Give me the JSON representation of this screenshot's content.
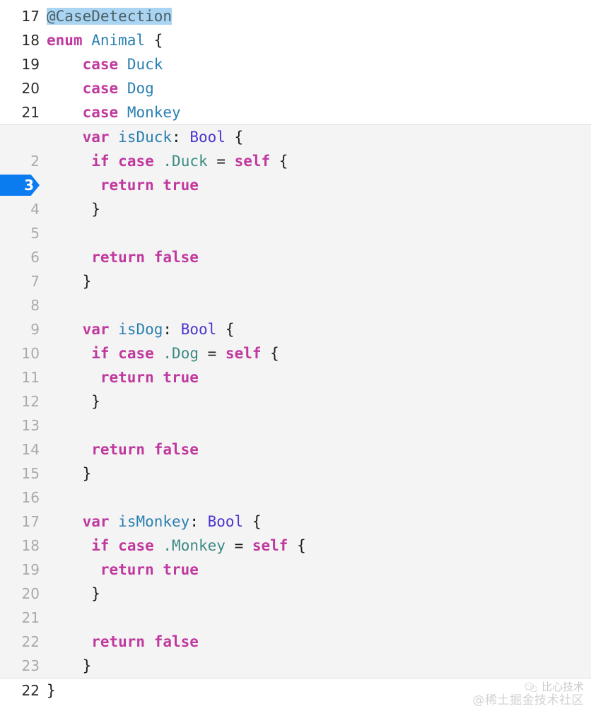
{
  "editor": {
    "language": "swift",
    "selection_text": "@CaseDetection",
    "current_line": "3",
    "colors": {
      "background": "#ffffff",
      "inner_background": "#f4f4f4",
      "divider": "#dcdcdc",
      "current_line_badge": "#0a7cf0",
      "selection": "#a9d4f2",
      "keyword": "#c0399e",
      "type": "#2a7fb0",
      "bool_type": "#4a35cf",
      "enum_member": "#3b8a84",
      "attribute": "#4a5f66",
      "punctuation": "#1c1c1c",
      "gutter_text": "#aaaaac"
    }
  },
  "panes": [
    {
      "id": "outer-top",
      "kind": "outer-top",
      "lines": [
        {
          "num": "17",
          "current": false,
          "tokens": [
            {
              "t": "@",
              "c": "attr sel"
            },
            {
              "t": "CaseDetection",
              "c": "attr sel"
            }
          ]
        },
        {
          "num": "18",
          "current": false,
          "tokens": [
            {
              "t": "enum",
              "c": "kw"
            },
            {
              "t": " ",
              "c": "punc"
            },
            {
              "t": "Animal",
              "c": "type"
            },
            {
              "t": " ",
              "c": "punc"
            },
            {
              "t": "{",
              "c": "punc"
            }
          ]
        },
        {
          "num": "19",
          "current": false,
          "tokens": [
            {
              "t": "    ",
              "c": "punc"
            },
            {
              "t": "case",
              "c": "kw"
            },
            {
              "t": " ",
              "c": "punc"
            },
            {
              "t": "Duck",
              "c": "type"
            }
          ]
        },
        {
          "num": "20",
          "current": false,
          "tokens": [
            {
              "t": "    ",
              "c": "punc"
            },
            {
              "t": "case",
              "c": "kw"
            },
            {
              "t": " ",
              "c": "punc"
            },
            {
              "t": "Dog",
              "c": "type"
            }
          ]
        },
        {
          "num": "21",
          "current": false,
          "tokens": [
            {
              "t": "    ",
              "c": "punc"
            },
            {
              "t": "case",
              "c": "kw"
            },
            {
              "t": " ",
              "c": "punc"
            },
            {
              "t": "Monkey",
              "c": "type"
            }
          ]
        }
      ]
    },
    {
      "id": "inner",
      "kind": "inner",
      "lines": [
        {
          "num": "",
          "current": false,
          "tokens": [
            {
              "t": "    ",
              "c": "punc"
            },
            {
              "t": "var",
              "c": "kw"
            },
            {
              "t": " ",
              "c": "punc"
            },
            {
              "t": "isDuck",
              "c": "ident"
            },
            {
              "t": ": ",
              "c": "punc"
            },
            {
              "t": "Bool",
              "c": "bool"
            },
            {
              "t": " {",
              "c": "punc"
            }
          ]
        },
        {
          "num": "2",
          "current": false,
          "tokens": [
            {
              "t": "     ",
              "c": "punc"
            },
            {
              "t": "if",
              "c": "kw"
            },
            {
              "t": " ",
              "c": "punc"
            },
            {
              "t": "case",
              "c": "kw"
            },
            {
              "t": " ",
              "c": "punc"
            },
            {
              "t": ".Duck",
              "c": "dot"
            },
            {
              "t": " = ",
              "c": "punc"
            },
            {
              "t": "self",
              "c": "kw"
            },
            {
              "t": " {",
              "c": "punc"
            }
          ]
        },
        {
          "num": "3",
          "current": true,
          "tokens": [
            {
              "t": "      ",
              "c": "punc"
            },
            {
              "t": "return",
              "c": "kw"
            },
            {
              "t": " ",
              "c": "punc"
            },
            {
              "t": "true",
              "c": "kw"
            }
          ]
        },
        {
          "num": "4",
          "current": false,
          "tokens": [
            {
              "t": "     ",
              "c": "punc"
            },
            {
              "t": "}",
              "c": "punc"
            }
          ]
        },
        {
          "num": "5",
          "current": false,
          "tokens": []
        },
        {
          "num": "6",
          "current": false,
          "tokens": [
            {
              "t": "     ",
              "c": "punc"
            },
            {
              "t": "return",
              "c": "kw"
            },
            {
              "t": " ",
              "c": "punc"
            },
            {
              "t": "false",
              "c": "kw"
            }
          ]
        },
        {
          "num": "7",
          "current": false,
          "tokens": [
            {
              "t": "    ",
              "c": "punc"
            },
            {
              "t": "}",
              "c": "punc"
            }
          ]
        },
        {
          "num": "8",
          "current": false,
          "tokens": []
        },
        {
          "num": "9",
          "current": false,
          "tokens": [
            {
              "t": "    ",
              "c": "punc"
            },
            {
              "t": "var",
              "c": "kw"
            },
            {
              "t": " ",
              "c": "punc"
            },
            {
              "t": "isDog",
              "c": "ident"
            },
            {
              "t": ": ",
              "c": "punc"
            },
            {
              "t": "Bool",
              "c": "bool"
            },
            {
              "t": " {",
              "c": "punc"
            }
          ]
        },
        {
          "num": "10",
          "current": false,
          "tokens": [
            {
              "t": "     ",
              "c": "punc"
            },
            {
              "t": "if",
              "c": "kw"
            },
            {
              "t": " ",
              "c": "punc"
            },
            {
              "t": "case",
              "c": "kw"
            },
            {
              "t": " ",
              "c": "punc"
            },
            {
              "t": ".Dog",
              "c": "dot"
            },
            {
              "t": " = ",
              "c": "punc"
            },
            {
              "t": "self",
              "c": "kw"
            },
            {
              "t": " {",
              "c": "punc"
            }
          ]
        },
        {
          "num": "11",
          "current": false,
          "tokens": [
            {
              "t": "      ",
              "c": "punc"
            },
            {
              "t": "return",
              "c": "kw"
            },
            {
              "t": " ",
              "c": "punc"
            },
            {
              "t": "true",
              "c": "kw"
            }
          ]
        },
        {
          "num": "12",
          "current": false,
          "tokens": [
            {
              "t": "     ",
              "c": "punc"
            },
            {
              "t": "}",
              "c": "punc"
            }
          ]
        },
        {
          "num": "13",
          "current": false,
          "tokens": []
        },
        {
          "num": "14",
          "current": false,
          "tokens": [
            {
              "t": "     ",
              "c": "punc"
            },
            {
              "t": "return",
              "c": "kw"
            },
            {
              "t": " ",
              "c": "punc"
            },
            {
              "t": "false",
              "c": "kw"
            }
          ]
        },
        {
          "num": "15",
          "current": false,
          "tokens": [
            {
              "t": "    ",
              "c": "punc"
            },
            {
              "t": "}",
              "c": "punc"
            }
          ]
        },
        {
          "num": "16",
          "current": false,
          "tokens": []
        },
        {
          "num": "17",
          "current": false,
          "tokens": [
            {
              "t": "    ",
              "c": "punc"
            },
            {
              "t": "var",
              "c": "kw"
            },
            {
              "t": " ",
              "c": "punc"
            },
            {
              "t": "isMonkey",
              "c": "ident"
            },
            {
              "t": ": ",
              "c": "punc"
            },
            {
              "t": "Bool",
              "c": "bool"
            },
            {
              "t": " {",
              "c": "punc"
            }
          ]
        },
        {
          "num": "18",
          "current": false,
          "tokens": [
            {
              "t": "     ",
              "c": "punc"
            },
            {
              "t": "if",
              "c": "kw"
            },
            {
              "t": " ",
              "c": "punc"
            },
            {
              "t": "case",
              "c": "kw"
            },
            {
              "t": " ",
              "c": "punc"
            },
            {
              "t": ".Monkey",
              "c": "dot"
            },
            {
              "t": " = ",
              "c": "punc"
            },
            {
              "t": "self",
              "c": "kw"
            },
            {
              "t": " {",
              "c": "punc"
            }
          ]
        },
        {
          "num": "19",
          "current": false,
          "tokens": [
            {
              "t": "      ",
              "c": "punc"
            },
            {
              "t": "return",
              "c": "kw"
            },
            {
              "t": " ",
              "c": "punc"
            },
            {
              "t": "true",
              "c": "kw"
            }
          ]
        },
        {
          "num": "20",
          "current": false,
          "tokens": [
            {
              "t": "     ",
              "c": "punc"
            },
            {
              "t": "}",
              "c": "punc"
            }
          ]
        },
        {
          "num": "21",
          "current": false,
          "tokens": []
        },
        {
          "num": "22",
          "current": false,
          "tokens": [
            {
              "t": "     ",
              "c": "punc"
            },
            {
              "t": "return",
              "c": "kw"
            },
            {
              "t": " ",
              "c": "punc"
            },
            {
              "t": "false",
              "c": "kw"
            }
          ]
        },
        {
          "num": "23",
          "current": false,
          "tokens": [
            {
              "t": "    ",
              "c": "punc"
            },
            {
              "t": "}",
              "c": "punc"
            }
          ]
        }
      ]
    },
    {
      "id": "outer-bottom",
      "kind": "outer-bottom",
      "lines": [
        {
          "num": "22",
          "current": false,
          "tokens": [
            {
              "t": "}",
              "c": "punc"
            }
          ]
        }
      ]
    }
  ],
  "watermark": {
    "icon": "wechat-icon",
    "account": "比心技术",
    "community": "@稀土掘金技术社区"
  }
}
